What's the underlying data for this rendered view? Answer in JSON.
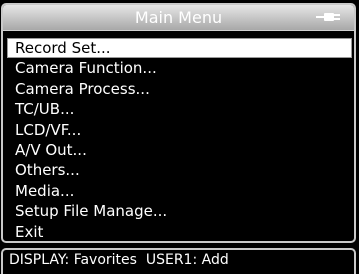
{
  "title": "Main Menu",
  "icons": {
    "power": "power-plug-icon"
  },
  "menu": {
    "items": [
      {
        "label": "Record Set...",
        "selected": true
      },
      {
        "label": "Camera Function...",
        "selected": false
      },
      {
        "label": "Camera Process...",
        "selected": false
      },
      {
        "label": "TC/UB...",
        "selected": false
      },
      {
        "label": "LCD/VF...",
        "selected": false
      },
      {
        "label": "A/V Out...",
        "selected": false
      },
      {
        "label": "Others...",
        "selected": false
      },
      {
        "label": "Media...",
        "selected": false
      },
      {
        "label": "Setup File Manage...",
        "selected": false
      },
      {
        "label": "Exit",
        "selected": false
      }
    ]
  },
  "status": {
    "text": "DISPLAY: Favorites  USER1: Add"
  }
}
